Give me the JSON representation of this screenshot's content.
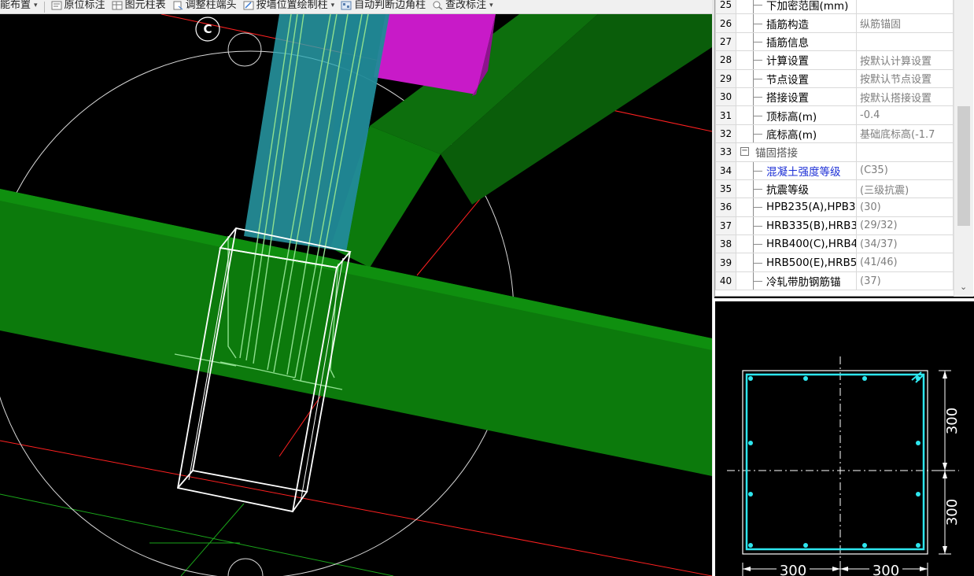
{
  "toolbar": {
    "items": [
      {
        "label": "能布置",
        "icon": "arrange-icon",
        "dropdown": true
      },
      {
        "label": "原位标注",
        "icon": "in-place-annotation-icon",
        "dropdown": false
      },
      {
        "label": "图元柱表",
        "icon": "column-table-icon",
        "dropdown": false
      },
      {
        "label": "调整柱端头",
        "icon": "adjust-column-end-icon",
        "dropdown": false
      },
      {
        "label": "按墙位置绘制柱",
        "icon": "draw-by-wall-icon",
        "dropdown": true
      },
      {
        "label": "自动判断边角柱",
        "icon": "auto-corner-column-icon",
        "dropdown": false
      },
      {
        "label": "查改标注",
        "icon": "check-annotation-icon",
        "dropdown": true
      }
    ]
  },
  "viewport": {
    "axis_label": "C",
    "colors": {
      "beam": "#0c7a0c",
      "column": "#2ec4c4",
      "block": "#c81ac8",
      "rebar": "#8fe08f",
      "axis": "#ff2020"
    }
  },
  "properties": {
    "rows": [
      {
        "num": "25",
        "name": "下加密范围(mm)",
        "value": "",
        "style": "child"
      },
      {
        "num": "26",
        "name": "插筋构造",
        "value": "纵筋锚固",
        "style": "child"
      },
      {
        "num": "27",
        "name": "插筋信息",
        "value": "",
        "style": "child"
      },
      {
        "num": "28",
        "name": "计算设置",
        "value": "按默认计算设置",
        "style": "child"
      },
      {
        "num": "29",
        "name": "节点设置",
        "value": "按默认节点设置",
        "style": "child"
      },
      {
        "num": "30",
        "name": "搭接设置",
        "value": "按默认搭接设置",
        "style": "child"
      },
      {
        "num": "31",
        "name": "顶标高(m)",
        "value": "-0.4",
        "style": "child"
      },
      {
        "num": "32",
        "name": "底标高(m)",
        "value": "基础底标高(-1.7",
        "style": "child"
      },
      {
        "num": "33",
        "name": "锚固搭接",
        "value": "",
        "style": "group",
        "toggle": "−"
      },
      {
        "num": "34",
        "name": "混凝土强度等级",
        "value": "(C35)",
        "style": "child-blue"
      },
      {
        "num": "35",
        "name": "抗震等级",
        "value": "(三级抗震)",
        "style": "child"
      },
      {
        "num": "36",
        "name": "HPB235(A),HPB3",
        "value": "(30)",
        "style": "child"
      },
      {
        "num": "37",
        "name": "HRB335(B),HRB3",
        "value": "(29/32)",
        "style": "child"
      },
      {
        "num": "38",
        "name": "HRB400(C),HRB4",
        "value": "(34/37)",
        "style": "child"
      },
      {
        "num": "39",
        "name": "HRB500(E),HRB5",
        "value": "(41/46)",
        "style": "child"
      },
      {
        "num": "40",
        "name": "冷轧带肋钢筋锚",
        "value": "(37)",
        "style": "child"
      }
    ],
    "scroll_down_icon": "chevron-down-icon"
  },
  "section": {
    "dim_right_top": "300",
    "dim_right_bottom": "300",
    "dim_bottom_left": "300",
    "dim_bottom_right": "300",
    "colors": {
      "stirrup": "#2ee6ee",
      "rebar_dot": "#2ee6ee",
      "outline": "#ffffff",
      "dimension": "#ffffff"
    }
  }
}
